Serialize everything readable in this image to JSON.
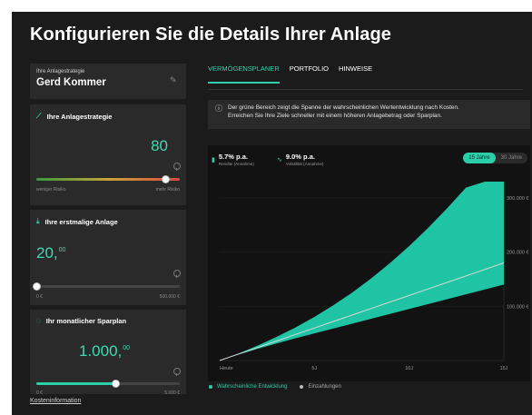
{
  "page": {
    "title": "Konfigurieren Sie die Details Ihrer Anlage"
  },
  "strategy_card": {
    "label": "Ihre Anlagestrategie",
    "name": "Gerd Kommer"
  },
  "risk_card": {
    "title": "Ihre Anlagestrategie",
    "value": "80",
    "level": 0.9,
    "min_label": "weniger Risiko",
    "max_label": "mehr Risiko",
    "gradient": [
      "#3a9a3a",
      "#c9a23a",
      "#d94a3a"
    ]
  },
  "initial_card": {
    "title": "Ihre erstmalige Anlage",
    "value": "20,",
    "cents": "00",
    "level": 0.0,
    "min_label": "0 €",
    "max_label": "500.000 €"
  },
  "monthly_card": {
    "title": "Ihr monatlicher Sparplan",
    "value": "1.000,",
    "cents": "00",
    "level": 0.55,
    "min_label": "0 €",
    "max_label": "5.000 €"
  },
  "footer": {
    "link": "Kosteninformation"
  },
  "tabs": [
    {
      "label": "VERMÖGENSPLANER",
      "active": true
    },
    {
      "label": "PORTFOLIO",
      "active": false
    },
    {
      "label": "HINWEISE",
      "active": false
    }
  ],
  "info": {
    "text_line1": "Der grüne Bereich zeigt die Spanne der wahrscheinlichen Wertentwicklung nach Kosten.",
    "text_line2": "Erreichen Sie Ihre Ziele schneller mit einem höheren Anlagebetrag oder Sparplan."
  },
  "stats": {
    "return_value": "5.7% p.a.",
    "return_label": "Rendite (Annahme)",
    "volatility_value": "9.0% p.a.",
    "volatility_label": "Volatilität (Annahme)"
  },
  "horizon": {
    "options": [
      "15 Jahre",
      "30 Jahre"
    ],
    "selected": "15 Jahre"
  },
  "legend": {
    "expected": "Wahrscheinliche Entwicklung",
    "deposits": "Einzahlungen"
  },
  "colors": {
    "accent": "#2bcfa9",
    "band": "#1fc4a4",
    "deposits": "#d8d8d8"
  },
  "chart_data": {
    "type": "area",
    "x": [
      0,
      1,
      2,
      3,
      4,
      5,
      6,
      7,
      8,
      9,
      10,
      11,
      12,
      13,
      14,
      15
    ],
    "x_tick_labels": [
      "Heute",
      "5J",
      "10J",
      "15J"
    ],
    "x_ticks": [
      0,
      5,
      10,
      15
    ],
    "y_tick_labels": [
      "300.000 €",
      "200.000 €",
      "100.000 €"
    ],
    "y_ticks": [
      300000,
      200000,
      100000
    ],
    "ylim": [
      0,
      330000
    ],
    "series": [
      {
        "name": "Einzahlungen",
        "values": [
          20,
          12020,
          24020,
          36020,
          48020,
          60020,
          72020,
          84020,
          96020,
          108020,
          120020,
          132020,
          144020,
          156020,
          168020,
          180020
        ]
      },
      {
        "name": "Wahrscheinliche Entwicklung",
        "band_upper": [
          20,
          13000,
          27500,
          43500,
          61000,
          80500,
          102000,
          125500,
          151500,
          180000,
          211000,
          244500,
          280500,
          319000,
          330000,
          330000
        ],
        "band_lower": [
          20,
          11000,
          21500,
          31500,
          41000,
          50000,
          59000,
          68000,
          77000,
          86000,
          95000,
          104000,
          113000,
          122000,
          131000,
          140000
        ]
      }
    ]
  }
}
